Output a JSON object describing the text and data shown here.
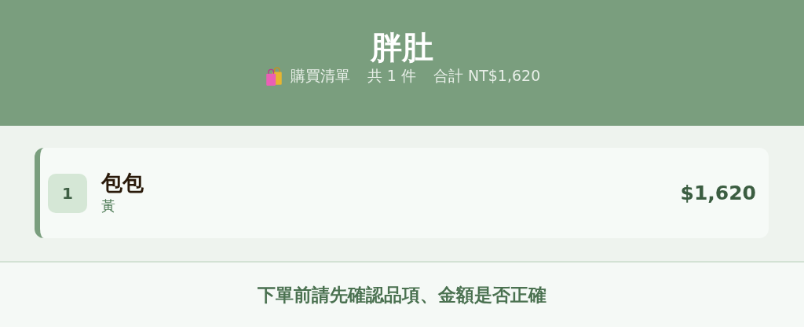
{
  "header": {
    "title": "胖肚",
    "subtitle": [
      "購買清單",
      "共 1 件",
      "合計 NT$1,620"
    ]
  },
  "items": [
    {
      "index": "1",
      "name": "包包",
      "variant": "黃",
      "price": "$1,620"
    }
  ],
  "footer": {
    "note": "下單前請先確認品項、金額是否正確"
  }
}
